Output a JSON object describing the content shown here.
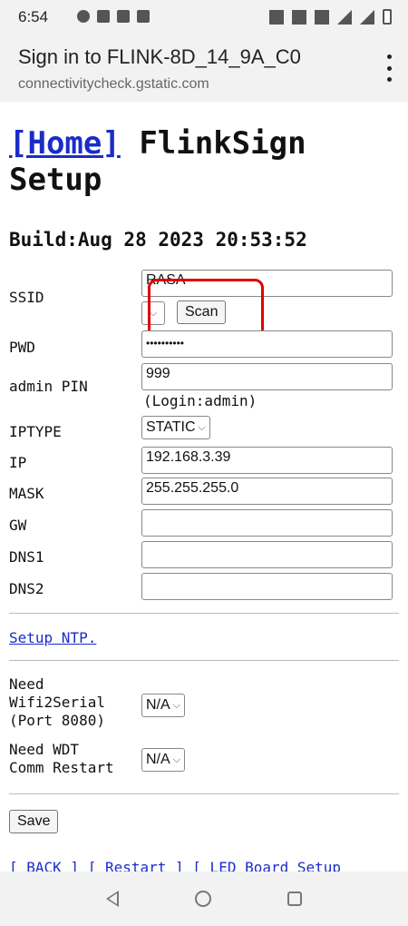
{
  "status_bar": {
    "time": "6:54"
  },
  "header": {
    "title": "Sign in to FLINK-8D_14_9A_C0",
    "url": "connectivitycheck.gstatic.com"
  },
  "page": {
    "home_link": "[Home]",
    "title_rest": "FlinkSign Setup",
    "build": "Build:Aug 28 2023 20:53:52"
  },
  "form": {
    "ssid_label": "SSID",
    "ssid_value": "RASA",
    "scan_button": "Scan",
    "pwd_label": "PWD",
    "pwd_value": "••••••••••",
    "admin_pin_label": "admin PIN",
    "admin_pin_value": "999",
    "admin_pin_hint": "(Login:admin)",
    "iptype_label": "IPTYPE",
    "iptype_value": "STATIC",
    "ip_label": "IP",
    "ip_value": "192.168.3.39",
    "mask_label": "MASK",
    "mask_value": "255.255.255.0",
    "gw_label": "GW",
    "gw_value": "",
    "dns1_label": "DNS1",
    "dns1_value": "",
    "dns2_label": "DNS2",
    "dns2_value": "",
    "ntp_link": "Setup NTP.",
    "wifi2serial_label_1": "Need",
    "wifi2serial_label_2": "Wifi2Serial",
    "wifi2serial_label_3": "(Port 8080)",
    "wifi2serial_value": "N/A",
    "wdt_label_1": "Need WDT",
    "wdt_label_2": "Comm Restart",
    "wdt_value": "N/A",
    "save_button": "Save"
  },
  "bottom_links": "[ BACK ] [ Restart ] [ LED Board Setup",
  "colors": {
    "link": "#1a2cc8",
    "highlight": "#e00000"
  }
}
